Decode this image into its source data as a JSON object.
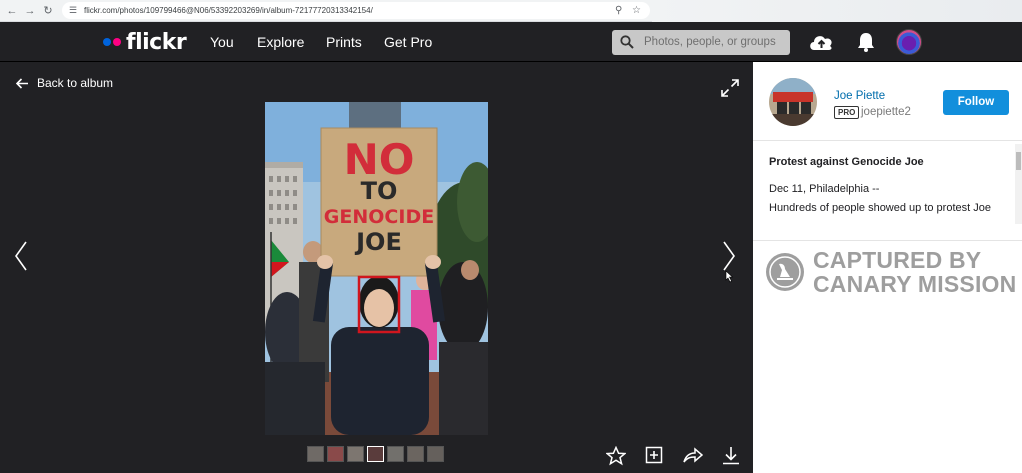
{
  "browser": {
    "url": "flickr.com/photos/109799466@N06/53392203269/in/album-72177720313342154/"
  },
  "nav": {
    "logo": "flickr",
    "links": [
      "You",
      "Explore",
      "Prints",
      "Get Pro"
    ],
    "search_placeholder": "Photos, people, or groups"
  },
  "viewer": {
    "back_label": "Back to album",
    "sign_lines": [
      "NO",
      "TO",
      "GENOCIDE",
      "JOE"
    ]
  },
  "owner": {
    "name": "Joe Piette",
    "pro_badge": "PRO",
    "handle": "joepiette2",
    "follow_label": "Follow"
  },
  "photo_info": {
    "title": "Protest against Genocide Joe",
    "description_line1": "Dec 11, Philadelphia --",
    "description_line2": "Hundreds of people showed up to protest Joe"
  },
  "watermark": {
    "line1": "CAPTURED BY",
    "line2": "CANARY MISSION"
  },
  "colors": {
    "accent": "#128fdc",
    "flickr_blue": "#0063dc",
    "flickr_pink": "#ff0084",
    "dark_bg": "#212124"
  }
}
